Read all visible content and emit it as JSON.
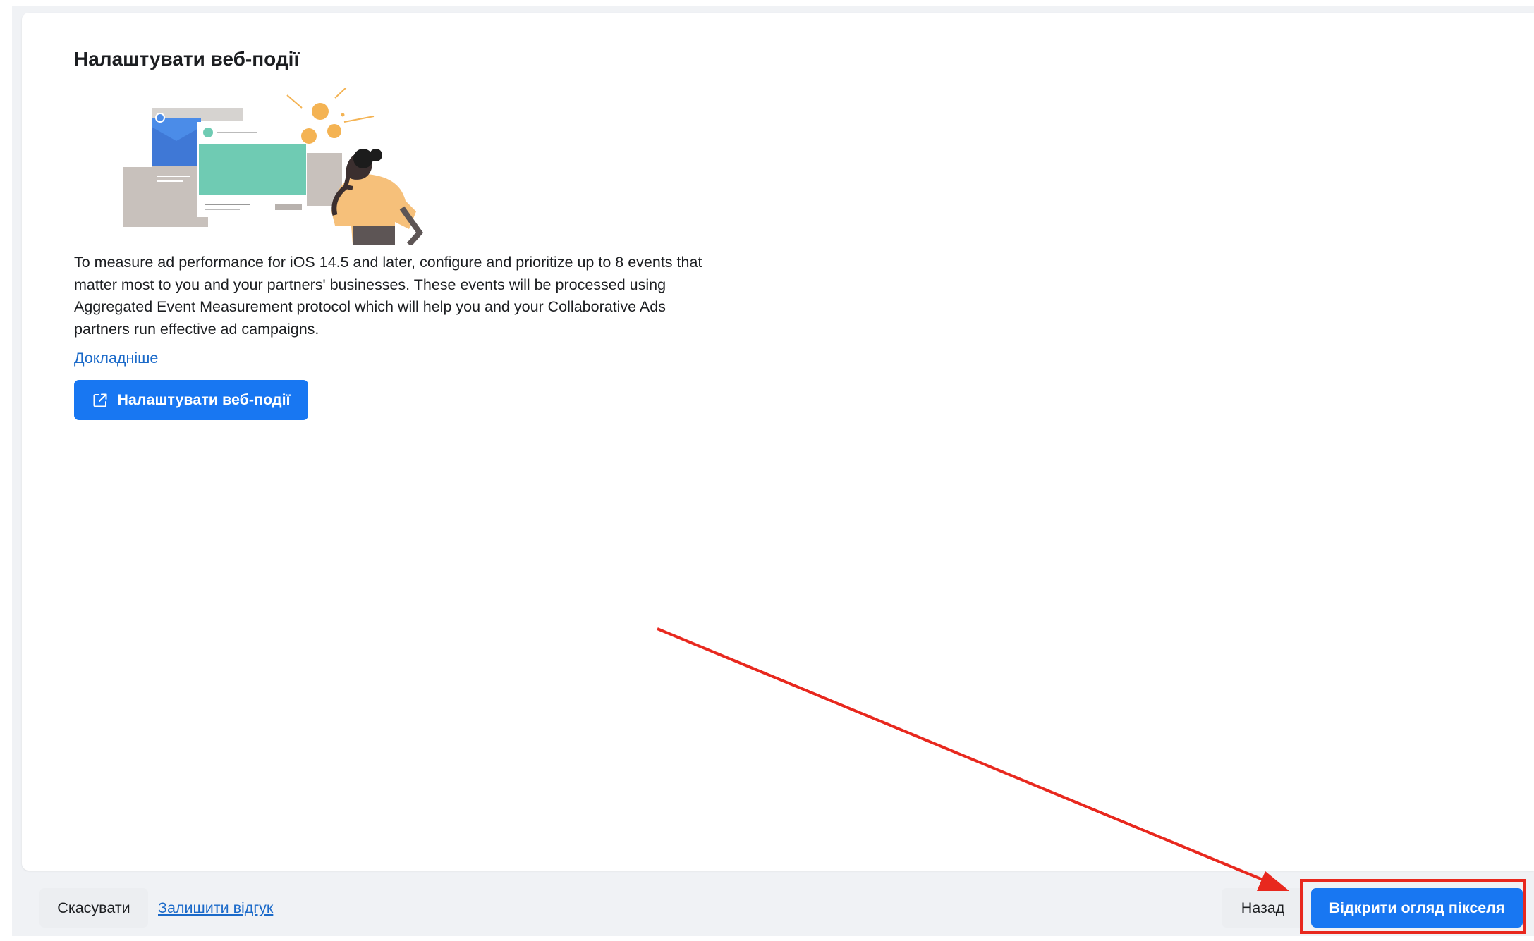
{
  "dialog": {
    "title": "Налаштувати веб-події",
    "description": "To measure ad performance for iOS 14.5 and later, configure and prioritize up to 8 events that matter most to you and your partners' businesses. These events will be processed using Aggregated Event Measurement protocol which will help you and your Collaborative Ads partners run effective ad campaigns.",
    "learn_more_label": "Докладніше",
    "configure_button_label": "Налаштувати веб-події",
    "configure_button_icon": "external-link-icon",
    "illustration": "person-with-screens-illustration"
  },
  "footer": {
    "cancel_label": "Скасувати",
    "feedback_label": "Залишити відгук",
    "back_label": "Назад",
    "open_pixel_label": "Відкрити огляд пікселя"
  },
  "colors": {
    "primary": "#1877f2",
    "link": "#1b6ac9",
    "annotation": "#e8281e",
    "background": "#f0f2f5"
  }
}
